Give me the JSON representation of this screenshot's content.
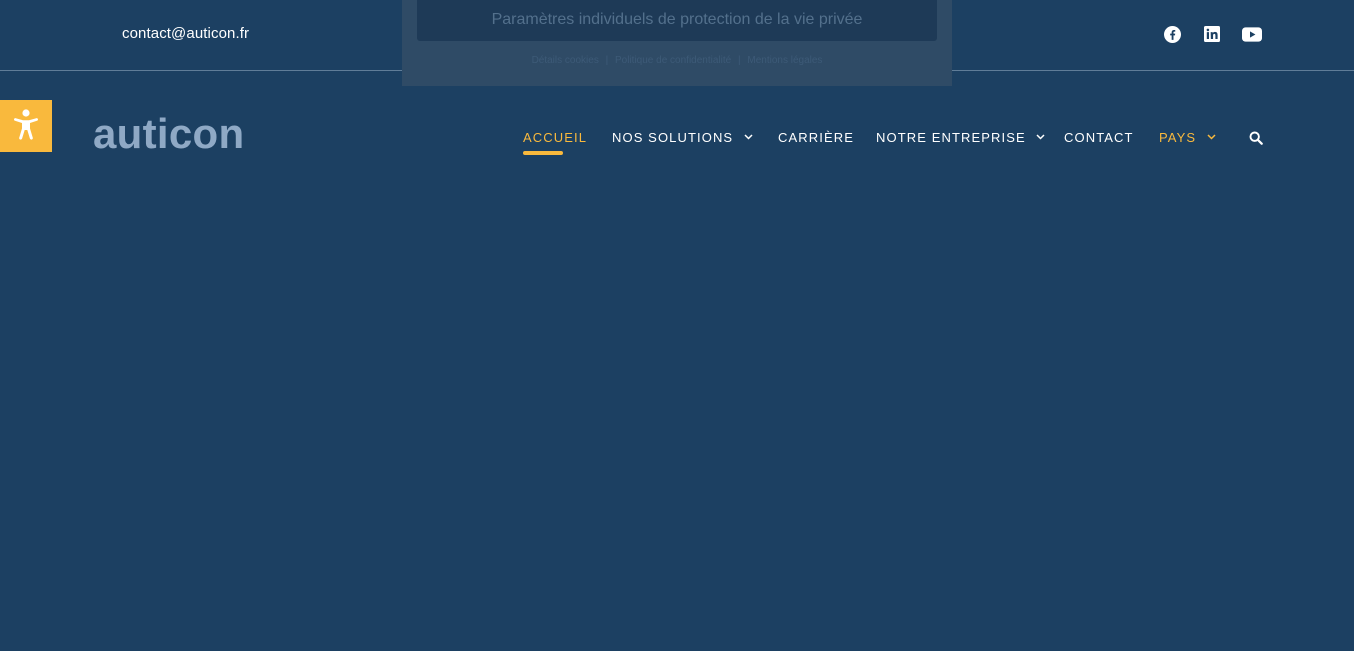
{
  "topbar": {
    "email": "contact@auticon.fr",
    "social_icons": [
      "facebook-icon",
      "linkedin-icon",
      "youtube-icon"
    ]
  },
  "cookie_banner": {
    "button_label": "Paramètres individuels de protection de la vie privée",
    "links": [
      "Détails cookies",
      "Politique de confidentialité",
      "Mentions légales"
    ],
    "link_separator": "|"
  },
  "accessibility": {
    "icon": "accessibility-icon"
  },
  "logo": {
    "text": "auticon"
  },
  "nav": {
    "items": [
      {
        "label": "ACCUEIL",
        "state": "active"
      },
      {
        "label": "NOS SOLUTIONS",
        "dropdown": true
      },
      {
        "label": "CARRIÈRE"
      },
      {
        "label": "NOTRE ENTREPRISE",
        "dropdown": true
      },
      {
        "label": "CONTACT"
      },
      {
        "label": "PAYS",
        "dropdown": true,
        "state": "highlight"
      }
    ],
    "search_icon": "search-icon"
  },
  "colors": {
    "background": "#1c4062",
    "accent": "#f9b93d",
    "logo": "#8fa9c5",
    "text": "#ffffff"
  }
}
